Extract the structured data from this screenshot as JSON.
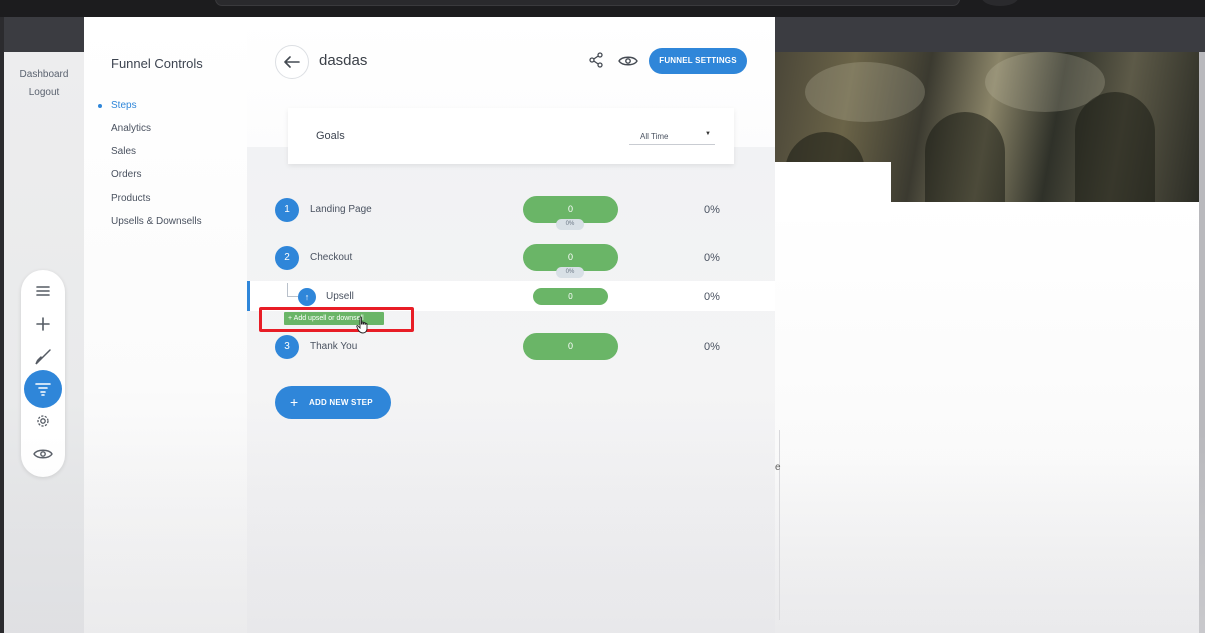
{
  "left_nav": {
    "dashboard": "Dashboard",
    "logout": "Logout"
  },
  "toolbar": {
    "tools": [
      {
        "icon": "menu-icon"
      },
      {
        "icon": "plus-icon"
      },
      {
        "icon": "brush-icon"
      },
      {
        "icon": "funnel-filter-icon",
        "active": true
      },
      {
        "icon": "gear-icon"
      },
      {
        "icon": "eye-icon"
      }
    ]
  },
  "funnel_controls": {
    "title": "Funnel Controls",
    "items": [
      {
        "label": "Steps",
        "active": true
      },
      {
        "label": "Analytics"
      },
      {
        "label": "Sales"
      },
      {
        "label": "Orders"
      },
      {
        "label": "Products"
      },
      {
        "label": "Upsells & Downsells"
      }
    ]
  },
  "header": {
    "title": "dasdas",
    "settings_label": "FUNNEL SETTINGS"
  },
  "goals": {
    "label": "Goals",
    "range": "All Time"
  },
  "steps": [
    {
      "num": "1",
      "name": "Landing Page",
      "count": "0",
      "sub": "0%",
      "pct": "0%"
    },
    {
      "num": "2",
      "name": "Checkout",
      "count": "0",
      "sub": "0%",
      "pct": "0%"
    },
    {
      "num": "↑",
      "name": "Upsell",
      "count": "0",
      "pct": "0%"
    },
    {
      "num": "3",
      "name": "Thank You",
      "count": "0",
      "pct": "0%"
    }
  ],
  "add_upsell_label": "+ Add upsell or downsell",
  "add_step_label": "ADD NEW STEP",
  "add_step_plus": "+",
  "background": {
    "partial_letter": "e"
  },
  "colors": {
    "accent_blue": "#2f86d9",
    "stat_green": "#6ab567",
    "highlight_red": "#e81d26"
  }
}
